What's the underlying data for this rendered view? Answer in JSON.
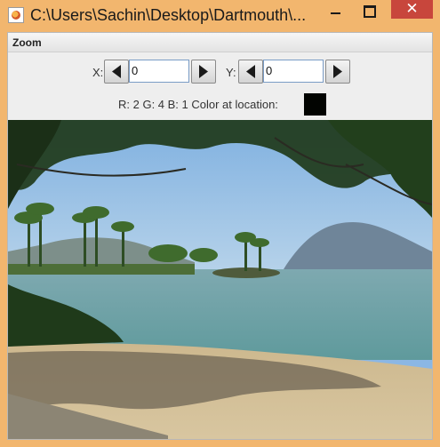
{
  "window": {
    "title": "C:\\Users\\Sachin\\Desktop\\Dartmouth\\...",
    "close_glyph": "✕"
  },
  "menu": {
    "zoom_label": "Zoom"
  },
  "controls": {
    "x_label": "X:",
    "x_value": "0",
    "y_label": "Y:",
    "y_value": "0"
  },
  "color_info": {
    "text": "R: 2  G: 4  B: 1  Color at location:",
    "swatch_color": "#020401"
  },
  "colors": {
    "titlebar": "#f2b66e",
    "close_button": "#c8463c"
  }
}
